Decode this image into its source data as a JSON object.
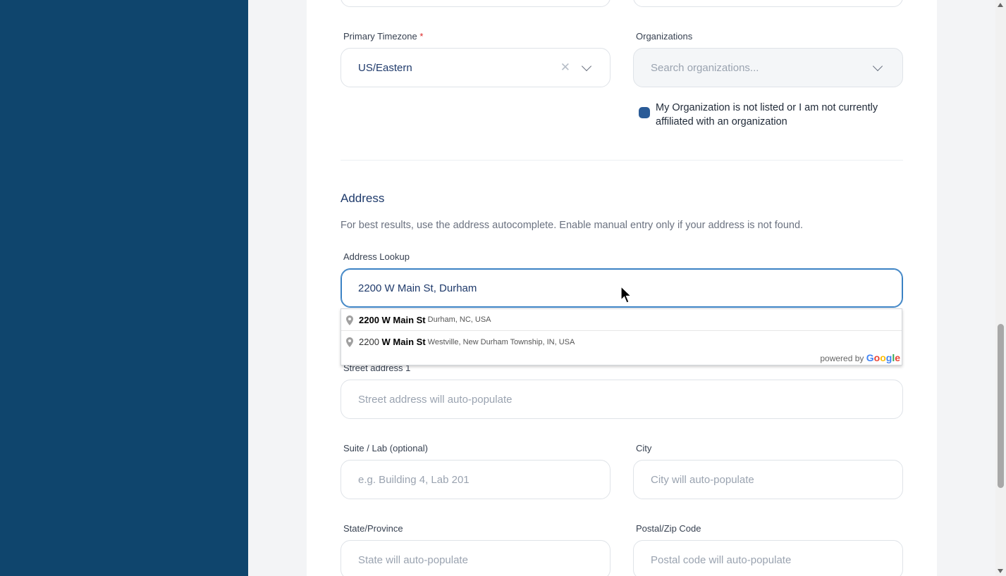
{
  "timezone": {
    "label": "Primary Timezone",
    "required_mark": "*",
    "value": "US/Eastern"
  },
  "organizations": {
    "label": "Organizations",
    "placeholder": "Search organizations...",
    "checkbox_label": "My Organization is not listed or I am not currently affiliated with an organization"
  },
  "address": {
    "title": "Address",
    "description": "For best results, use the address autocomplete. Enable manual entry only if your address is not found.",
    "lookup_label": "Address Lookup",
    "lookup_value": "2200 W Main St, Durham",
    "suggestions": [
      {
        "prefix": "",
        "main": "2200 W Main St",
        "secondary": "Durham, NC, USA"
      },
      {
        "prefix": "2200 ",
        "main": "W Main St",
        "secondary": "Westville, New Durham Township, IN, USA"
      }
    ],
    "powered_by": "powered by",
    "google": "Google",
    "street1_label": "Street address 1",
    "street1_placeholder": "Street address will auto-populate",
    "suite_label": "Suite / Lab (optional)",
    "suite_placeholder": "e.g. Building 4, Lab 201",
    "city_label": "City",
    "city_placeholder": "City will auto-populate",
    "state_label": "State/Province",
    "state_placeholder": "State will auto-populate",
    "postal_label": "Postal/Zip Code",
    "postal_placeholder": "Postal code will auto-populate"
  },
  "colors": {
    "left_panel": "#0f456d",
    "checkbox": "#2a5b97",
    "focus_border": "#3b82c4"
  }
}
